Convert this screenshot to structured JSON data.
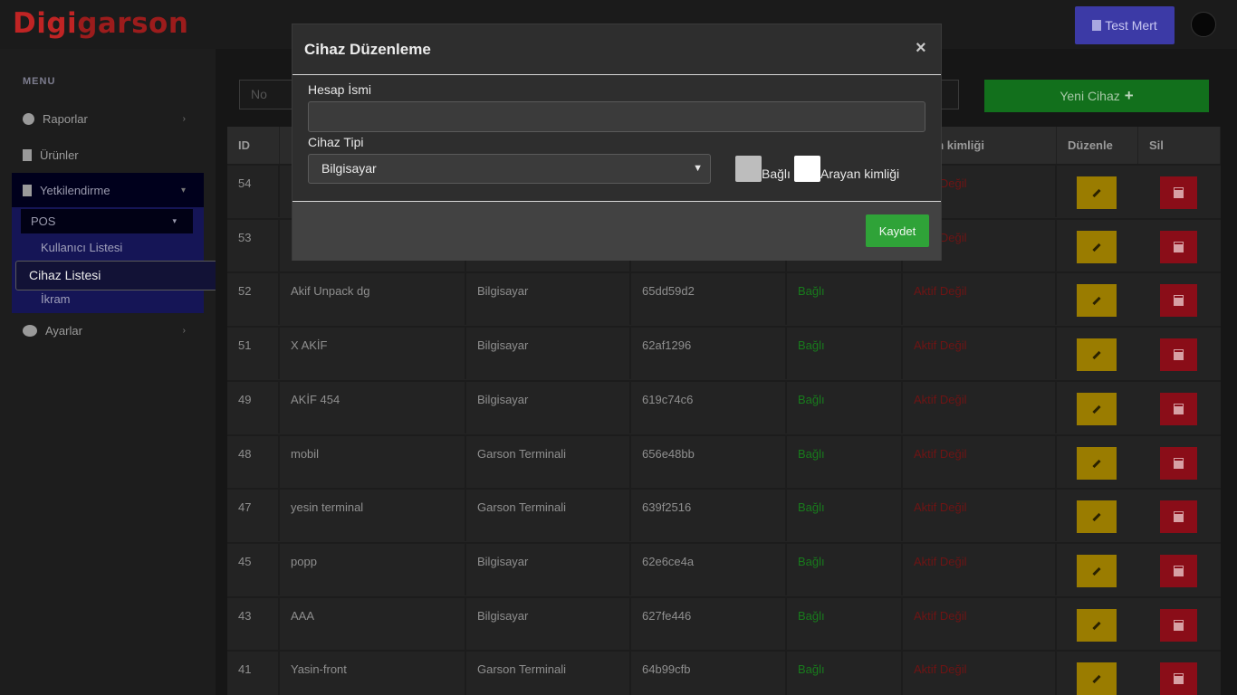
{
  "app": {
    "logo_part1": "Digi",
    "logo_part2": "garson"
  },
  "header": {
    "user_label": "Test Mert"
  },
  "sidebar": {
    "menu_title": "MENU",
    "items": [
      {
        "label": "Raporlar"
      },
      {
        "label": "Ürünler"
      },
      {
        "label": "Yetkilendirme"
      },
      {
        "label": "Ayarlar"
      }
    ],
    "pos_label": "POS",
    "sub_items": [
      {
        "label": "Kullanıcı Listesi"
      },
      {
        "label": "Cihaz Listesi"
      },
      {
        "label": "İkram"
      }
    ]
  },
  "toolbar": {
    "search_placeholder": "No",
    "new_device_label": "Yeni Cihaz"
  },
  "table": {
    "headers": {
      "id": "ID",
      "caller": "an kimliği",
      "edit": "Düzenle",
      "delete": "Sil"
    },
    "rows": [
      {
        "id": "54",
        "name": "",
        "type": "",
        "code": "",
        "status": "",
        "caller": "Aktif Değil"
      },
      {
        "id": "53",
        "name": "",
        "type": "",
        "code": "",
        "status": "",
        "caller": "Aktif Değil"
      },
      {
        "id": "52",
        "name": "Akif Unpack dg",
        "type": "Bilgisayar",
        "code": "65dd59d2",
        "status": "Bağlı",
        "caller": "Aktif Değil"
      },
      {
        "id": "51",
        "name": "X AKİF",
        "type": "Bilgisayar",
        "code": "62af1296",
        "status": "Bağlı",
        "caller": "Aktif Değil"
      },
      {
        "id": "49",
        "name": "AKİF 454",
        "type": "Bilgisayar",
        "code": "619c74c6",
        "status": "Bağlı",
        "caller": "Aktif Değil"
      },
      {
        "id": "48",
        "name": "mobil",
        "type": "Garson Terminali",
        "code": "656e48bb",
        "status": "Bağlı",
        "caller": "Aktif Değil"
      },
      {
        "id": "47",
        "name": "yesin terminal",
        "type": "Garson Terminali",
        "code": "639f2516",
        "status": "Bağlı",
        "caller": "Aktif Değil"
      },
      {
        "id": "45",
        "name": "popp",
        "type": "Bilgisayar",
        "code": "62e6ce4a",
        "status": "Bağlı",
        "caller": "Aktif Değil"
      },
      {
        "id": "43",
        "name": "AAA",
        "type": "Bilgisayar",
        "code": "627fe446",
        "status": "Bağlı",
        "caller": "Aktif Değil"
      },
      {
        "id": "41",
        "name": "Yasin-front",
        "type": "Garson Terminali",
        "code": "64b99cfb",
        "status": "Bağlı",
        "caller": "Aktif Değil"
      }
    ]
  },
  "modal": {
    "title": "Cihaz Düzenleme",
    "close": "×",
    "account_name_label": "Hesap İsmi",
    "account_name_value": "",
    "device_type_label": "Cihaz Tipi",
    "device_type_value": "Bilgisayar",
    "connected_label": "Bağlı",
    "caller_id_label": "Arayan kimliği",
    "save_label": "Kaydet"
  },
  "colors": {
    "accent_green": "#2fa338",
    "edit_yellow": "#9a7c00",
    "delete_red": "#8a0d18",
    "user_blue": "#3c3aa6"
  }
}
